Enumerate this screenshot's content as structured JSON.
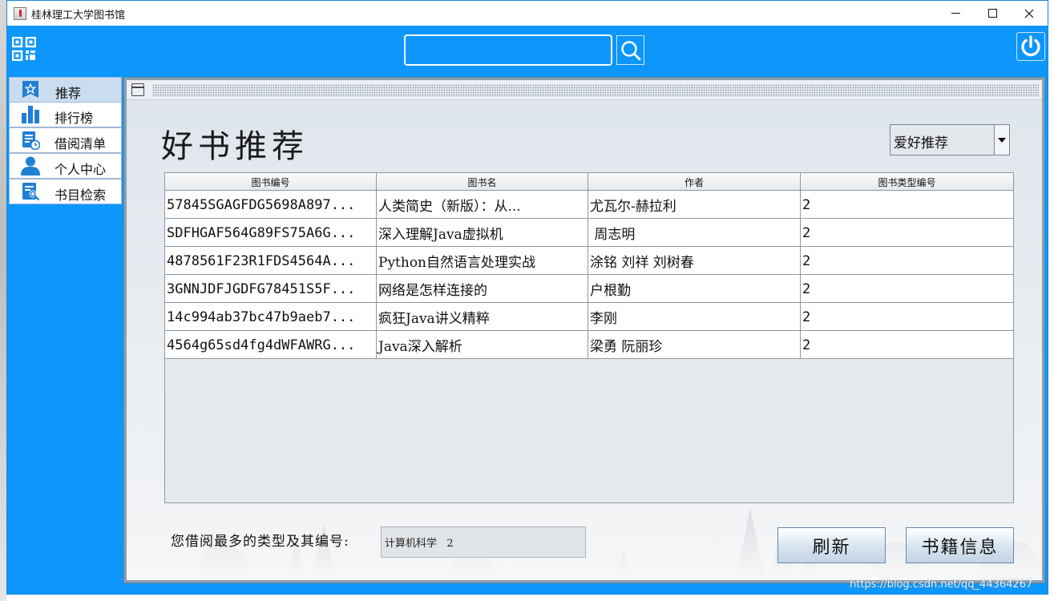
{
  "window": {
    "title": "桂林理工大学图书馆",
    "controls": {
      "minimize": "minimize-icon",
      "maximize": "maximize-icon",
      "close": "close-icon"
    }
  },
  "topbar": {
    "search": {
      "value": "",
      "placeholder": ""
    },
    "icons": [
      "qr-code-icon",
      "search-icon",
      "power-icon"
    ]
  },
  "sidebar": {
    "items": [
      {
        "label": "推荐",
        "icon": "star-icon",
        "active": true
      },
      {
        "label": "排行榜",
        "icon": "bar-chart-icon",
        "active": false
      },
      {
        "label": "借阅清单",
        "icon": "document-clock-icon",
        "active": false
      },
      {
        "label": "个人中心",
        "icon": "user-icon",
        "active": false
      },
      {
        "label": "书目检索",
        "icon": "document-search-icon",
        "active": false
      }
    ]
  },
  "content": {
    "title": "好书推荐",
    "filter": {
      "selected": "爱好推荐"
    },
    "table": {
      "columns": [
        "图书编号",
        "图书名",
        "作者",
        "图书类型编号"
      ],
      "rows": [
        [
          "57845SGAGFDG5698A897...",
          "人类简史（新版）：从...",
          "尤瓦尔-赫拉利",
          "2"
        ],
        [
          "SDFHGAF564G89FS75A6G...",
          "深入理解Java虚拟机",
          " 周志明",
          "2"
        ],
        [
          "4878561F23R1FDS4564A...",
          "Python自然语言处理实战",
          "涂铭 刘祥 刘树春",
          "2"
        ],
        [
          "3GNNJDFJGDFG78451S5F...",
          "网络是怎样连接的",
          "户根勤",
          "2"
        ],
        [
          "14c994ab37bc47b9aeb7...",
          "疯狂Java讲义精粹",
          "李刚",
          "2"
        ],
        [
          "4564g65sd4fg4dWFAWRG...",
          "Java深入解析",
          "梁勇 阮丽珍",
          "2"
        ]
      ]
    },
    "favorite": {
      "label": "您借阅最多的类型及其编号:",
      "value": "计算机科学   2"
    },
    "buttons": {
      "refresh": "刷新",
      "book_info": "书籍信息"
    }
  },
  "watermark": "https://blog.csdn.net/qq_44364267",
  "colors": {
    "accent": "#0d96fb",
    "nav_active": "#c9ddef",
    "content_bg": "#e6ebf0"
  }
}
